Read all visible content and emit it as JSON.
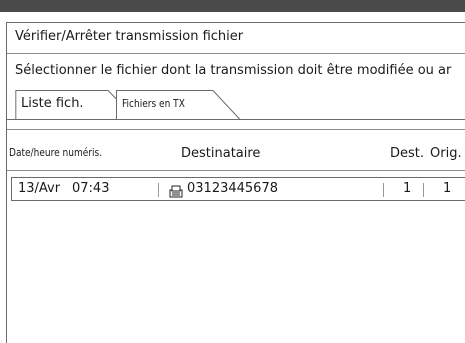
{
  "panel": {
    "title": "Vérifier/Arrêter transmission fichier",
    "instruction": "Sélectionner le fichier dont la transmission doit être modifiée ou ar"
  },
  "tabs": [
    {
      "label": "Liste fich.",
      "selected": false
    },
    {
      "label": "Fichiers en TX",
      "selected": true
    }
  ],
  "table": {
    "headers": {
      "datetime": "Date/heure numéris.",
      "recipient": "Destinataire",
      "dest": "Dest.",
      "orig": "Orig."
    },
    "rows": [
      {
        "date": "13/Avr",
        "time": "07:43",
        "icon": "fax-icon",
        "recipient": "03123445678",
        "dest": "1",
        "orig": "1"
      }
    ]
  }
}
